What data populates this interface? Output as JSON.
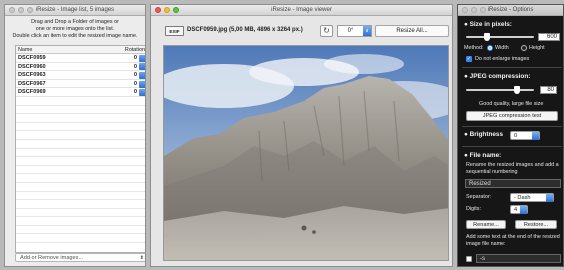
{
  "list_window": {
    "title": "iResize - Image list, 5 images",
    "instructions": [
      "Drag and Drop a Folder of images or",
      "one or more images onto the list.",
      "Double click an item to edit the resized image name."
    ],
    "columns": [
      "Name",
      "Rotation"
    ],
    "rows": [
      {
        "name": "DSCF0959",
        "rotation": "0"
      },
      {
        "name": "DSCF0960",
        "rotation": "0"
      },
      {
        "name": "DSCF0963",
        "rotation": "0"
      },
      {
        "name": "DSCF0967",
        "rotation": "0"
      },
      {
        "name": "DSCF0969",
        "rotation": "0"
      }
    ],
    "add_remove_label": "Add or Remove images..."
  },
  "viewer_window": {
    "title": "iResize - Image viewer",
    "exif_label": "EXIF",
    "file_info": "DSCF0959.jpg  (5,00 MB, 4896 x 3264 px.)",
    "angle": "0°",
    "resize_all_label": "Resize All..."
  },
  "options_window": {
    "title": "iResize - Options",
    "size_title": "Size in pixels:",
    "size_value": "600",
    "method_label": "Method:",
    "width_label": "Width",
    "height_label": "Height",
    "method_selected": "Width",
    "no_enlarge_label": "Do not enlarge images",
    "no_enlarge_checked": true,
    "jpeg_title": "JPEG compression:",
    "jpeg_value": "80",
    "jpeg_note": "Good quality, large file size",
    "jpeg_test_label": "JPEG compression test",
    "brightness_title": "Brightness",
    "brightness_value": "0",
    "filename_title": "File name:",
    "filename_note": "Rename the resized images and add a sequential numbering",
    "base_name": "Resized",
    "separator_label": "Separator:",
    "separator_value": "- Dash",
    "digits_label": "Digits:",
    "digits_value": "4",
    "rename_label": "Rename...",
    "restore_label": "Restore...",
    "suffix_note": "Add some text at the end of the resized image file name:",
    "suffix_value": "-s"
  },
  "colors": {
    "accent": "#3a82f7",
    "options_bg": "#161616",
    "window_bg": "#ececec"
  }
}
